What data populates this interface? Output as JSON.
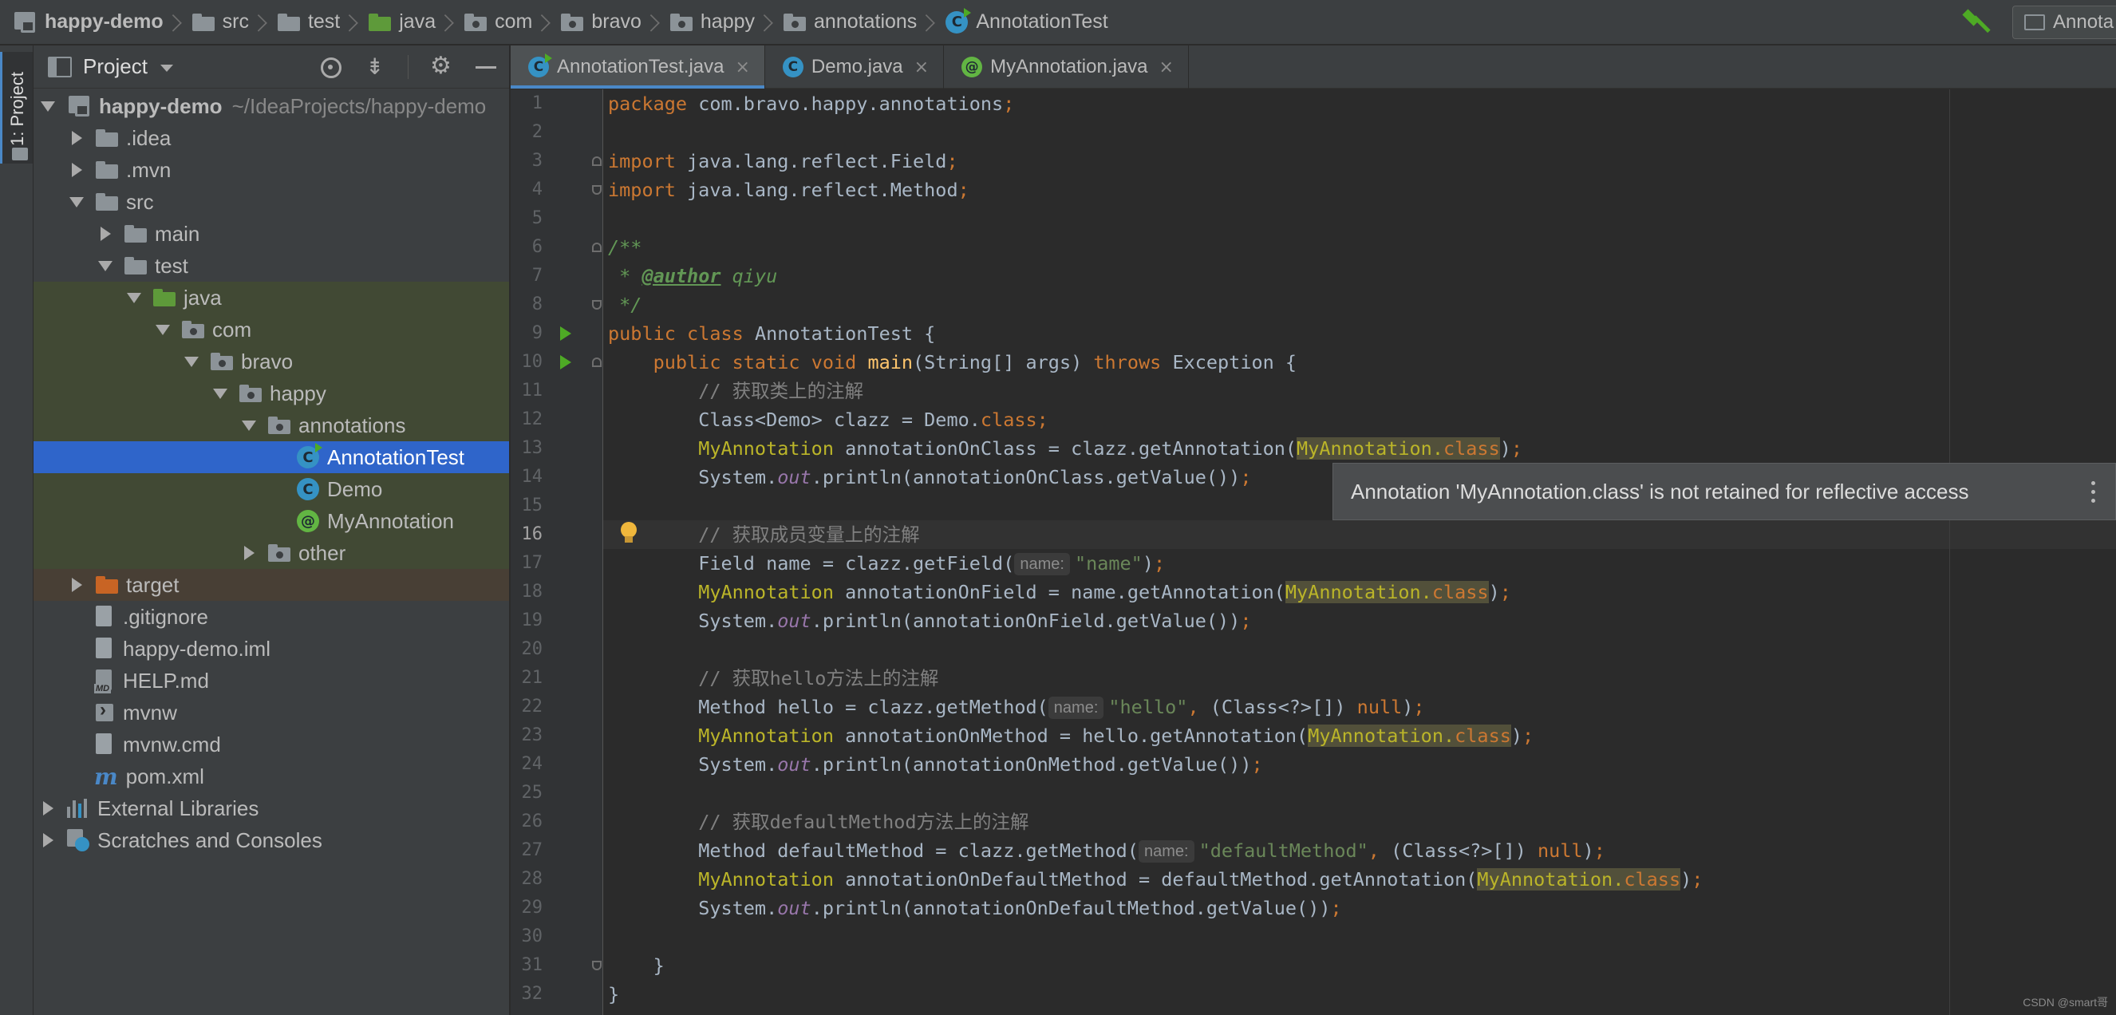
{
  "window": {
    "breadcrumbs": [
      {
        "label": "happy-demo",
        "icon": "project-icon"
      },
      {
        "label": "src",
        "icon": "folder-icon"
      },
      {
        "label": "test",
        "icon": "folder-icon"
      },
      {
        "label": "java",
        "icon": "test-source-folder-icon"
      },
      {
        "label": "com",
        "icon": "package-icon"
      },
      {
        "label": "bravo",
        "icon": "package-icon"
      },
      {
        "label": "happy",
        "icon": "package-icon"
      },
      {
        "label": "annotations",
        "icon": "package-icon"
      },
      {
        "label": "AnnotationTest",
        "icon": "java-class-icon"
      }
    ],
    "run_config_label": "Annota",
    "build_icon": "hammer-icon",
    "accent_color": "#4a88c7",
    "selection_color": "#2f65ca"
  },
  "tool_stripe": {
    "project_tab_label": "1: Project"
  },
  "project_panel": {
    "title": "Project",
    "icons": [
      "locate-icon",
      "collapse-all-icon",
      "gear-icon",
      "minimize-icon"
    ],
    "root": {
      "name": "happy-demo",
      "path": "~/IdeaProjects/happy-demo"
    },
    "items": {
      "idea": ".idea",
      "mvn": ".mvn",
      "src": "src",
      "main": "main",
      "test": "test",
      "java": "java",
      "com": "com",
      "bravo": "bravo",
      "happy": "happy",
      "annotations": "annotations",
      "annotation_test": "AnnotationTest",
      "demo": "Demo",
      "my_annotation": "MyAnnotation",
      "other": "other",
      "target": "target",
      "gitignore": ".gitignore",
      "iml": "happy-demo.iml",
      "help_md": "HELP.md",
      "mvnw": "mvnw",
      "mvnw_cmd": "mvnw.cmd",
      "pom": "pom.xml",
      "external_libraries": "External Libraries",
      "scratches": "Scratches and Consoles"
    },
    "md_badge": "MD"
  },
  "tabs": [
    {
      "label": "AnnotationTest.java",
      "icon": "java-class-icon",
      "active": true
    },
    {
      "label": "Demo.java",
      "icon": "java-class-icon",
      "active": false
    },
    {
      "label": "MyAnnotation.java",
      "icon": "annotation-icon",
      "active": false
    }
  ],
  "tab_close_glyph": "×",
  "editor": {
    "current_line": 16,
    "lines": [
      {
        "n": "1"
      },
      {
        "n": "2"
      },
      {
        "n": "3"
      },
      {
        "n": "4"
      },
      {
        "n": "5"
      },
      {
        "n": "6"
      },
      {
        "n": "7"
      },
      {
        "n": "8"
      },
      {
        "n": "9"
      },
      {
        "n": "10"
      },
      {
        "n": "11"
      },
      {
        "n": "12"
      },
      {
        "n": "13"
      },
      {
        "n": "14"
      },
      {
        "n": "15"
      },
      {
        "n": "16"
      },
      {
        "n": "17"
      },
      {
        "n": "18"
      },
      {
        "n": "19"
      },
      {
        "n": "20"
      },
      {
        "n": "21"
      },
      {
        "n": "22"
      },
      {
        "n": "23"
      },
      {
        "n": "24"
      },
      {
        "n": "25"
      },
      {
        "n": "26"
      },
      {
        "n": "27"
      },
      {
        "n": "28"
      },
      {
        "n": "29"
      },
      {
        "n": "30"
      },
      {
        "n": "31"
      },
      {
        "n": "32"
      }
    ],
    "code": {
      "l1": {
        "kw": "package",
        "pkg": " com.bravo.happy.annotations",
        "semi": ";"
      },
      "l3": {
        "kw": "import",
        "path": " java.lang.reflect.Field",
        "semi": ";"
      },
      "l4": {
        "kw": "import",
        "path": " java.lang.reflect.Method",
        "semi": ";"
      },
      "l6": "/**",
      "l7": {
        "star": " * ",
        "tag": "@author",
        "value": " qiyu"
      },
      "l8": " */",
      "l9": {
        "kw1": "public",
        "kw2": "class",
        "name": " AnnotationTest {"
      },
      "l10": {
        "kw1": "public",
        "kw2": "static",
        "kw3": "void",
        "fn": "main",
        "params": "(String[] args) ",
        "kw4": "throws",
        "rest": " Exception {"
      },
      "l11": "// 获取类上的注解",
      "l12": {
        "pre": "Class<Demo> clazz = Demo.",
        "kw": "class",
        "semi": ";"
      },
      "l13": {
        "an": "MyAnnotation",
        "mid": " annotationOnClass = clazz.getAnnotation(",
        "warn_type": "MyAnnotation.",
        "warn_kw": "class",
        "end": ")",
        "semi": ";"
      },
      "l14": {
        "pre": "System.",
        "out": "out",
        "post": ".println(annotationOnClass.getValue())",
        "semi": ";"
      },
      "l16": "// 获取成员变量上的注解",
      "l17": {
        "pre": "Field name = clazz.getField(",
        "hint": "name:",
        "str": "\"name\"",
        "post": ")",
        "semi": ";"
      },
      "l18": {
        "an": "MyAnnotation",
        "mid": " annotationOnField = name.getAnnotation(",
        "warn_type": "MyAnnotation.",
        "warn_kw": "class",
        "end": ")",
        "semi": ";"
      },
      "l19": {
        "pre": "System.",
        "out": "out",
        "post": ".println(annotationOnField.getValue())",
        "semi": ";"
      },
      "l21": "// 获取hello方法上的注解",
      "l22": {
        "pre": "Method hello = clazz.getMethod(",
        "hint": "name:",
        "str": "\"hello\"",
        "comma": ",",
        "mid": " (Class<?>[]) ",
        "kw": "null",
        "post": ")",
        "semi": ";"
      },
      "l23": {
        "an": "MyAnnotation",
        "mid": " annotationOnMethod = hello.getAnnotation(",
        "warn_type": "MyAnnotation.",
        "warn_kw": "class",
        "end": ")",
        "semi": ";"
      },
      "l24": {
        "pre": "System.",
        "out": "out",
        "post": ".println(annotationOnMethod.getValue())",
        "semi": ";"
      },
      "l26": "// 获取defaultMethod方法上的注解",
      "l27": {
        "pre": "Method defaultMethod = clazz.getMethod(",
        "hint": "name:",
        "str": "\"defaultMethod\"",
        "comma": ",",
        "mid": " (Class<?>[]) ",
        "kw": "null",
        "post": ")",
        "semi": ";"
      },
      "l28": {
        "an": "MyAnnotation",
        "mid": " annotationOnDefaultMethod = defaultMethod.getAnnotation(",
        "warn_type": "MyAnnotation.",
        "warn_kw": "class",
        "end": ")",
        "semi": ";"
      },
      "l29": {
        "pre": "System.",
        "out": "out",
        "post": ".println(annotationOnDefaultMethod.getValue())",
        "semi": ";"
      },
      "l31": "}",
      "l32": "}"
    },
    "syntax_colors": {
      "keyword": "#cc7832",
      "string": "#6a8759",
      "comment": "#808080",
      "doc_comment": "#629755",
      "method": "#ffc66d",
      "static_field": "#9876aa",
      "annotation": "#bbb529",
      "text": "#a9b7c6"
    }
  },
  "tooltip": {
    "text": "Annotation 'MyAnnotation.class' is not retained for reflective access",
    "more_icon": "more-vertical-icon"
  },
  "watermark": "CSDN @smart哥"
}
